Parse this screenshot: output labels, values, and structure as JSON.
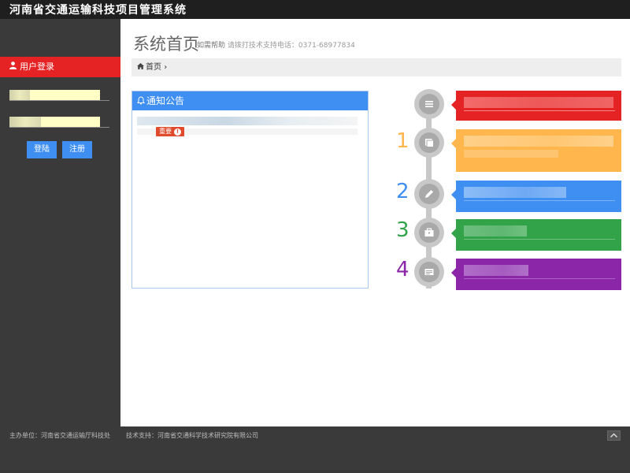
{
  "app": {
    "title": "河南省交通运输科技项目管理系统"
  },
  "sidebar": {
    "login_header": "用户登录",
    "user_icon": "user-icon",
    "login_button": "登陆",
    "register_button": "注册"
  },
  "page": {
    "title": "系统首页",
    "help_label": "如需帮助",
    "support_label": "请拨打技术支持电话：0371-68977834"
  },
  "breadcrumb": {
    "home_icon": "home-icon",
    "home_label": "首页",
    "separator": "›"
  },
  "notice": {
    "bell_icon": "bell-icon",
    "title": "通知公告",
    "badge_label": "重要",
    "badge_icon": "exclamation-icon"
  },
  "timeline": {
    "steps": [
      {
        "number": "",
        "icon": "list-icon",
        "color": "#e52224"
      },
      {
        "number": "1",
        "icon": "book-icon",
        "color": "#ffb64d"
      },
      {
        "number": "2",
        "icon": "pencil-icon",
        "color": "#3f8ff2"
      },
      {
        "number": "3",
        "icon": "briefcase-icon",
        "color": "#33a34a"
      },
      {
        "number": "4",
        "icon": "card-icon",
        "color": "#8b26a8"
      }
    ]
  },
  "footer": {
    "host": "主办单位：河南省交通运输厅科技处",
    "support": "技术支持：河南省交通科学技术研究院有限公司",
    "top_icon": "chevron-up-icon"
  }
}
